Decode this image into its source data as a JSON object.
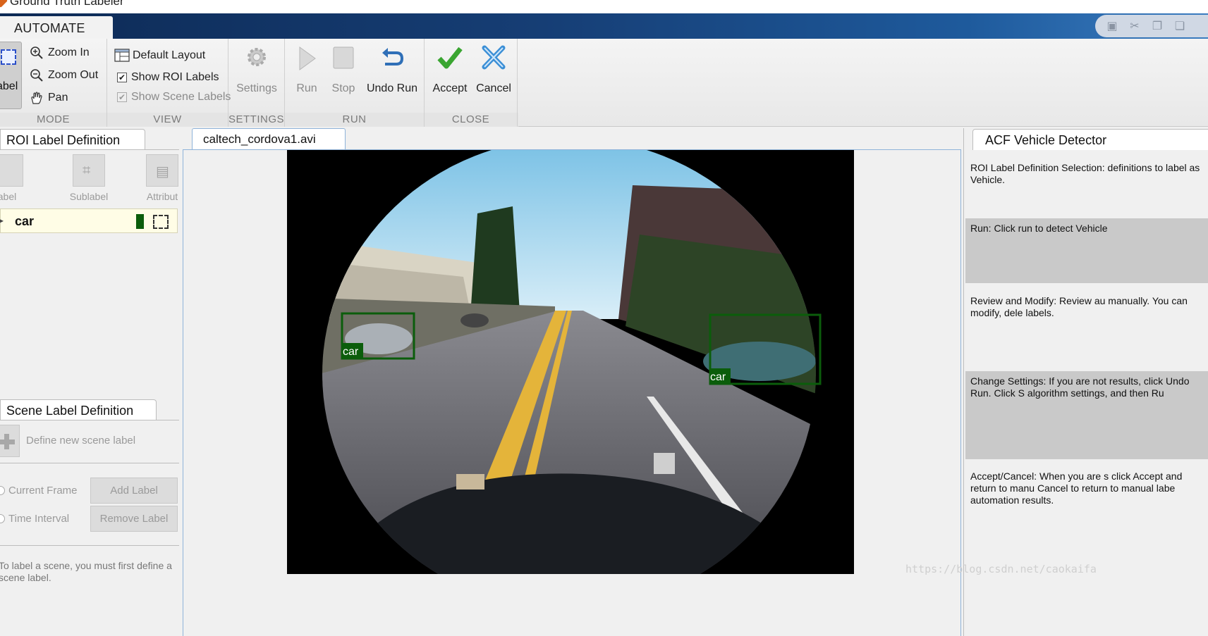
{
  "window": {
    "title": "Ground Truth Labeler"
  },
  "ribbon_tabs": {
    "automate": "AUTOMATE"
  },
  "ribbon": {
    "mode": {
      "section_label": "MODE",
      "roi_button_label": "abel",
      "zoom_in": "Zoom In",
      "zoom_out": "Zoom Out",
      "pan": "Pan"
    },
    "view": {
      "section_label": "VIEW",
      "default_layout": "Default Layout",
      "show_roi_labels": "Show ROI Labels",
      "show_scene_labels": "Show Scene Labels"
    },
    "settings": {
      "section_label": "SETTINGS",
      "settings": "Settings"
    },
    "run": {
      "section_label": "RUN",
      "run": "Run",
      "stop": "Stop",
      "undo_run": "Undo Run"
    },
    "close": {
      "section_label": "CLOSE",
      "accept": "Accept",
      "cancel": "Cancel"
    }
  },
  "roi_panel": {
    "title": "ROI Label Definition",
    "tools": {
      "label": "abel",
      "sublabel": "Sublabel",
      "attribute": "Attribut"
    },
    "labels": [
      {
        "name": "car",
        "color": "#0b5d0b"
      }
    ]
  },
  "scene_panel": {
    "title": "Scene Label Definition",
    "placeholder": "Define new scene label",
    "current_frame": "Current Frame",
    "time_interval": "Time Interval",
    "add_label": "Add Label",
    "remove_label": "Remove Label",
    "note": "To label a scene, you must first define a scene label."
  },
  "video": {
    "tab": "caltech_cordova1.avi",
    "detections": [
      {
        "label": "car"
      },
      {
        "label": "car"
      }
    ]
  },
  "right_panel": {
    "title": "ACF Vehicle Detector",
    "steps": [
      "ROI Label Definition Selection: definitions to label as Vehicle.",
      "Run: Click run to detect Vehicle",
      "Review and Modify: Review au manually. You can modify, dele labels.",
      "Change Settings: If you are not results, click Undo Run. Click S algorithm settings, and then Ru",
      "Accept/Cancel: When you are s click Accept and return to manu Cancel to return to manual labe automation results."
    ]
  },
  "watermark": "https://blog.csdn.net/caokaifa"
}
